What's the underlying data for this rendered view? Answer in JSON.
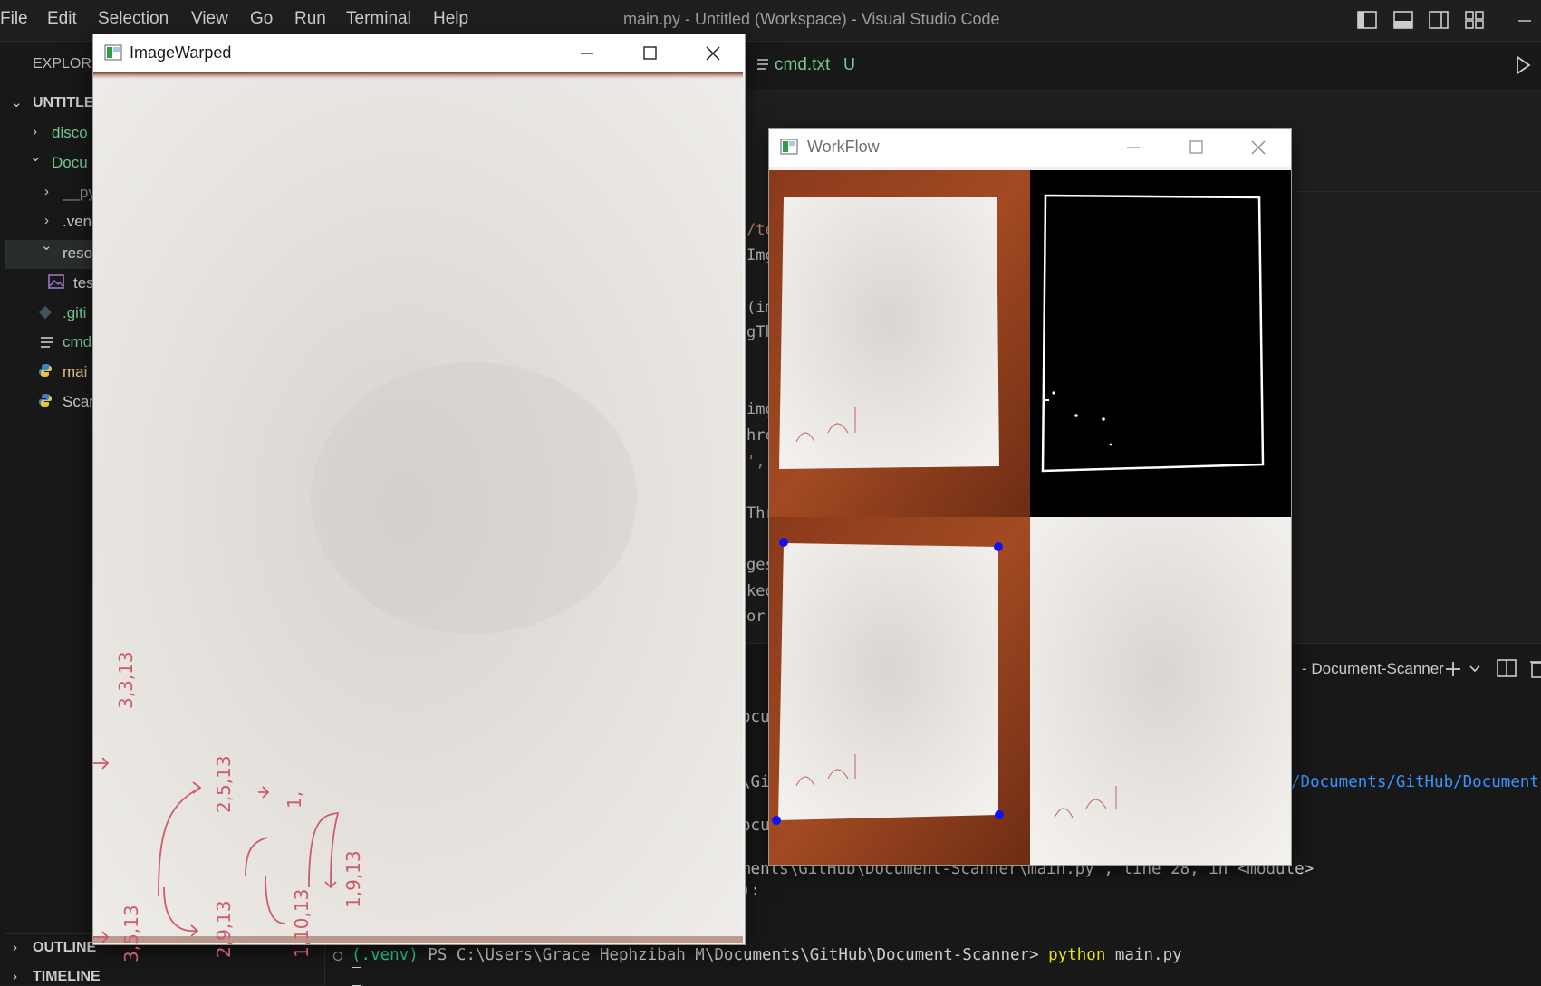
{
  "vscode": {
    "menu": [
      "File",
      "Edit",
      "Selection",
      "View",
      "Go",
      "Run",
      "Terminal",
      "Help"
    ],
    "window_title": "main.py - Untitled (Workspace) - Visual Studio Code",
    "explorer_label": "EXPLORE",
    "tree": {
      "root": "UNTITLE",
      "items": [
        {
          "label": "disco",
          "color": "#73c991"
        },
        {
          "label": "Docu",
          "color": "#73c991"
        },
        {
          "label": "__py",
          "color": "#8c8c8c"
        },
        {
          "label": ".ven",
          "color": "#cccccc"
        },
        {
          "label": "reso",
          "color": "#cccccc"
        },
        {
          "label": "tes",
          "color": "#cccccc"
        },
        {
          "label": ".giti",
          "color": "#73c991"
        },
        {
          "label": "cmd",
          "color": "#73c991"
        },
        {
          "label": "mai",
          "color": "#e2c08d"
        },
        {
          "label": "Scar",
          "color": "#cccccc"
        }
      ],
      "outline": "OUTLINE",
      "timeline": "TIMELINE"
    },
    "tab": {
      "label": "cmd.txt",
      "badge": "U"
    },
    "code_frags": [
      "/te",
      "Img",
      "(im",
      "gTh",
      "img",
      "hre",
      "',",
      "Thr",
      "ges",
      "ked",
      " or"
    ],
    "terminal": {
      "tab_label": "- Document-Scanner",
      "frag1": "ocu",
      "frag2": "\\Git",
      "frag2_path": "/Documents/GitHub/Document",
      "frag3": "ocu",
      "traceback": "ments\\GitHub\\Document-Scanner\\main.py\", line 28, in <module>",
      "frag4": "):",
      "prompt_venv": "(.venv)",
      "prompt_path": " PS C:\\Users\\Grace Hephzibah M\\Documents\\GitHub\\Document-Scanner> ",
      "cmd_python": "python",
      "cmd_file": " main.py"
    }
  },
  "windows": {
    "warped": {
      "title": "ImageWarped"
    },
    "workflow": {
      "title": "WorkFlow"
    }
  },
  "handwriting": {
    "warped": [
      "3,3,13",
      "2,5,13",
      "1,",
      "1,9,13",
      "3,5,13",
      "2,9,13",
      "1,10,13"
    ]
  }
}
